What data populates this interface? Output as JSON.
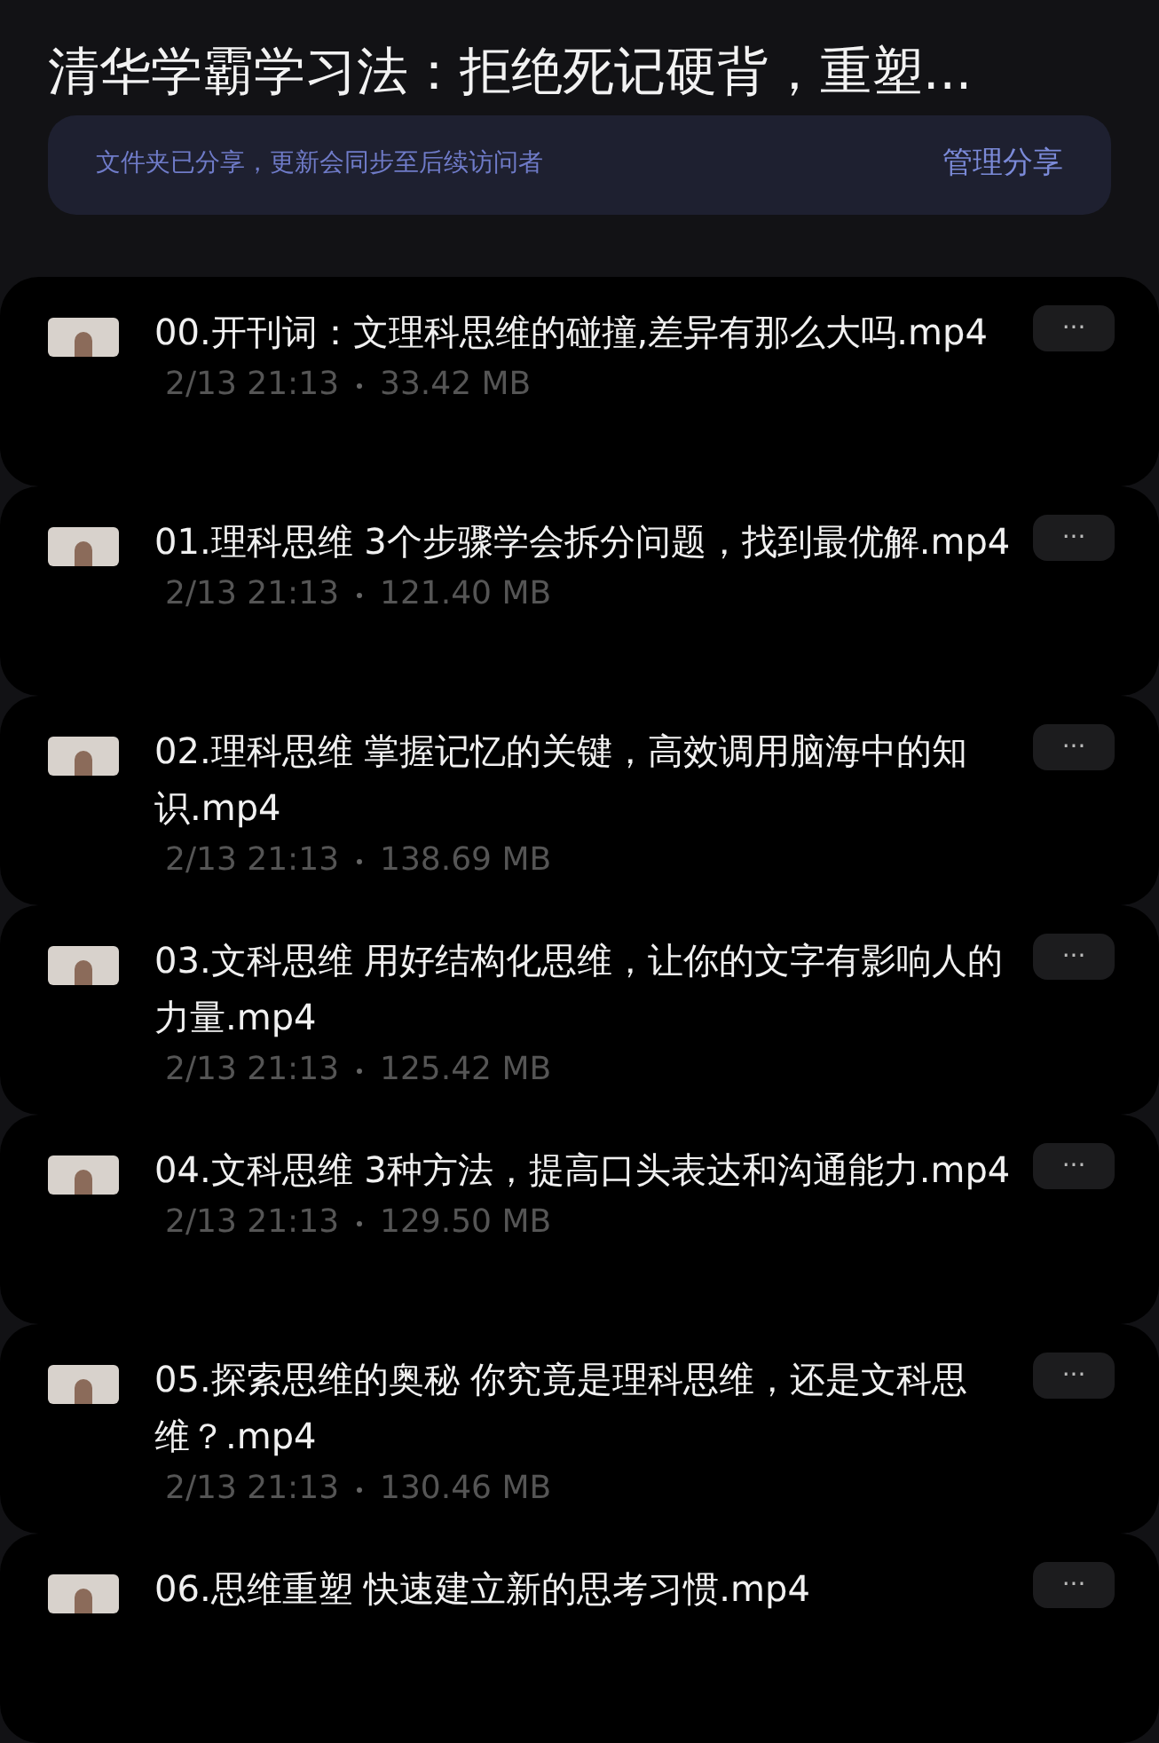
{
  "header": {
    "title": "清华学霸学习法：拒绝死记硬背，重塑..."
  },
  "share_banner": {
    "message": "文件夹已分享，更新会同步至后续访问者",
    "action": "管理分享"
  },
  "files": [
    {
      "name": "00.开刊词：文理科思维的碰撞,差异有那么大吗.mp4",
      "date": "2/13 21:13",
      "size": "33.42 MB",
      "more": "···"
    },
    {
      "name": "01.理科思维 3个步骤学会拆分问题，找到最优解.mp4",
      "date": "2/13 21:13",
      "size": "121.40 MB",
      "more": "···"
    },
    {
      "name": "02.理科思维 掌握记忆的关键，高效调用脑海中的知识.mp4",
      "date": "2/13 21:13",
      "size": "138.69 MB",
      "more": "···"
    },
    {
      "name": "03.文科思维 用好结构化思维，让你的文字有影响人的力量.mp4",
      "date": "2/13 21:13",
      "size": "125.42 MB",
      "more": "···"
    },
    {
      "name": "04.文科思维 3种方法，提高口头表达和沟通能力.mp4",
      "date": "2/13 21:13",
      "size": "129.50 MB",
      "more": "···"
    },
    {
      "name": "05.探索思维的奥秘 你究竟是理科思维，还是文科思维？.mp4",
      "date": "2/13 21:13",
      "size": "130.46 MB",
      "more": "···"
    },
    {
      "name": "06.思维重塑 快速建立新的思考习惯.mp4",
      "more": "···"
    }
  ]
}
